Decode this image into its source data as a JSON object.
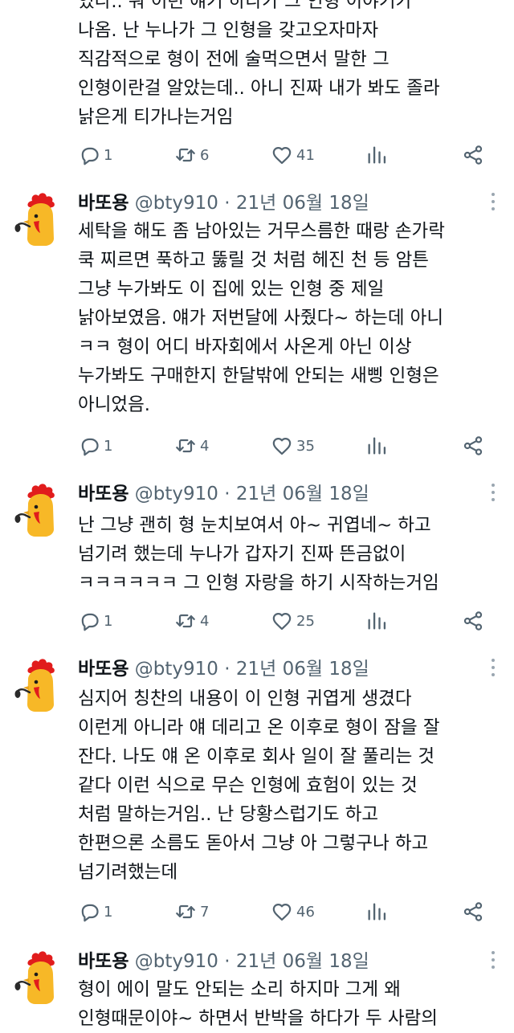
{
  "top_tweet": {
    "lines": [
      "었다.. 뭐 이런 얘기 하다가 그 인형 이야기가",
      "나옴. 난 누나가 그 인형을 갖고오자마자",
      "직감적으로 형이 전에 술먹으면서 말한 그",
      "인형이란걸 알았는데.. 아니 진짜 내가 봐도 졸라",
      "낡은게 티가나는거임"
    ],
    "stats": {
      "replies": "1",
      "retweets": "6",
      "likes": "41"
    }
  },
  "tweets": [
    {
      "name": "바또용",
      "handle": "@bty910",
      "dot": "·",
      "date": "21년 06월 18일",
      "lines": [
        "세탁을 해도 좀 남아있는 거무스름한 때랑 손가락",
        "쿡 찌르면 푹하고 뚫릴 것 처럼 헤진 천 등 암튼",
        "그냥 누가봐도 이 집에 있는 인형 중 제일",
        "낡아보였음. 얘가 저번달에 사줬다~ 하는데 아니",
        "ㅋㅋ 형이 어디 바자회에서 사온게 아닌 이상",
        "누가봐도 구매한지 한달밖에 안되는 새삥 인형은",
        "아니었음."
      ],
      "stats": {
        "replies": "1",
        "retweets": "4",
        "likes": "35"
      }
    },
    {
      "name": "바또용",
      "handle": "@bty910",
      "dot": "·",
      "date": "21년 06월 18일",
      "lines": [
        "난 그냥 괜히 형 눈치보여서 아~ 귀엽네~ 하고",
        "넘기려 했는데 누나가 갑자기 진짜 뜬금없이",
        "ㅋㅋㅋㅋㅋㅋ 그 인형 자랑을 하기 시작하는거임"
      ],
      "stats": {
        "replies": "1",
        "retweets": "4",
        "likes": "25"
      }
    },
    {
      "name": "바또용",
      "handle": "@bty910",
      "dot": "·",
      "date": "21년 06월 18일",
      "lines": [
        "심지어 칭찬의 내용이 이 인형 귀엽게 생겼다",
        "이런게 아니라 얘 데리고 온 이후로 형이 잠을 잘",
        "잔다. 나도 얘 온 이후로 회사 일이 잘 풀리는 것",
        "같다 이런 식으로 무슨 인형에 효험이 있는 것",
        "처럼 말하는거임.. 난 당황스럽기도 하고",
        "한편으론 소름도 돋아서 그냥 아 그렇구나 하고",
        "넘기려했는데"
      ],
      "stats": {
        "replies": "1",
        "retweets": "7",
        "likes": "46"
      }
    },
    {
      "name": "바또용",
      "handle": "@bty910",
      "dot": "·",
      "date": "21년 06월 18일",
      "lines": [
        "형이 에이 말도 안되는 소리 하지마 그게 왜",
        "인형때문이야~ 하면서 반박을 하다가 두 사람의"
      ]
    }
  ],
  "colors": {
    "text": "#0f1419",
    "secondary": "#536471",
    "avatar_red": "#e11c1c",
    "avatar_yellow": "#f7b827"
  },
  "icons": [
    "reply-icon",
    "retweet-icon",
    "like-icon",
    "views-icon",
    "share-icon",
    "more-icon",
    "chick-avatar"
  ]
}
